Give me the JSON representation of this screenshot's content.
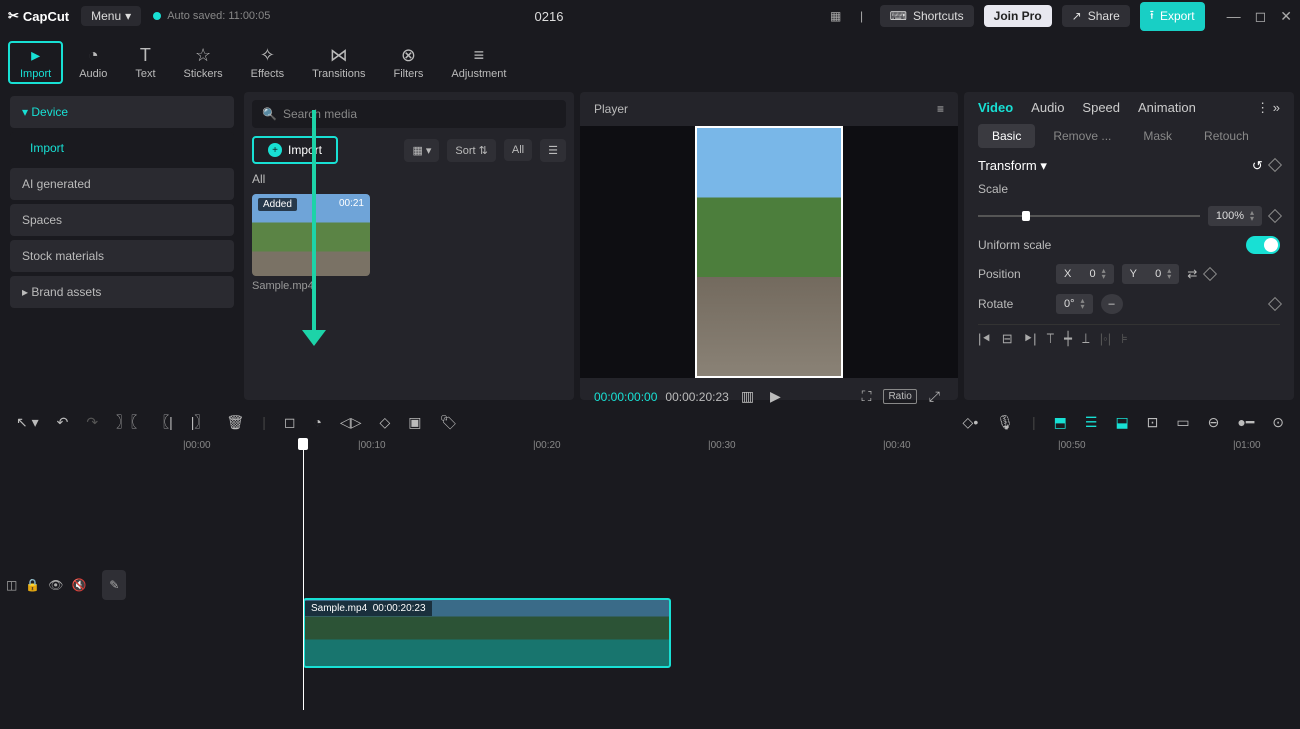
{
  "titlebar": {
    "logo": "CapCut",
    "menu": "Menu",
    "autosaved": "Auto saved: 11:00:05",
    "project": "0216",
    "shortcuts": "Shortcuts",
    "join_pro": "Join Pro",
    "share": "Share",
    "export": "Export"
  },
  "toolbar": {
    "import": "Import",
    "audio": "Audio",
    "text": "Text",
    "stickers": "Stickers",
    "effects": "Effects",
    "transitions": "Transitions",
    "filters": "Filters",
    "adjustment": "Adjustment"
  },
  "sidebar": {
    "device": "Device",
    "import": "Import",
    "ai": "AI generated",
    "spaces": "Spaces",
    "stock": "Stock materials",
    "brand": "Brand assets"
  },
  "media": {
    "search_placeholder": "Search media",
    "import_btn": "Import",
    "sort": "Sort",
    "all_btn": "All",
    "all_label": "All",
    "thumb_added": "Added",
    "thumb_dur": "00:21",
    "thumb_name": "Sample.mp4"
  },
  "player": {
    "title": "Player",
    "current": "00:00:00:00",
    "total": "00:00:20:23",
    "ratio": "Ratio"
  },
  "properties": {
    "tabs": {
      "video": "Video",
      "audio": "Audio",
      "speed": "Speed",
      "animation": "Animation"
    },
    "subtabs": {
      "basic": "Basic",
      "remove": "Remove ...",
      "mask": "Mask",
      "retouch": "Retouch"
    },
    "transform": "Transform",
    "scale_label": "Scale",
    "scale_value": "100%",
    "uniform": "Uniform scale",
    "position": "Position",
    "pos_x_label": "X",
    "pos_x": "0",
    "pos_y_label": "Y",
    "pos_y": "0",
    "rotate": "Rotate",
    "rotate_value": "0°",
    "dash": "–"
  },
  "timeline": {
    "ruler": [
      "|00:00",
      "|00:10",
      "|00:20",
      "|00:30",
      "|00:40",
      "|00:50",
      "|01:00"
    ],
    "clip_name": "Sample.mp4",
    "clip_dur": "00:00:20:23"
  }
}
